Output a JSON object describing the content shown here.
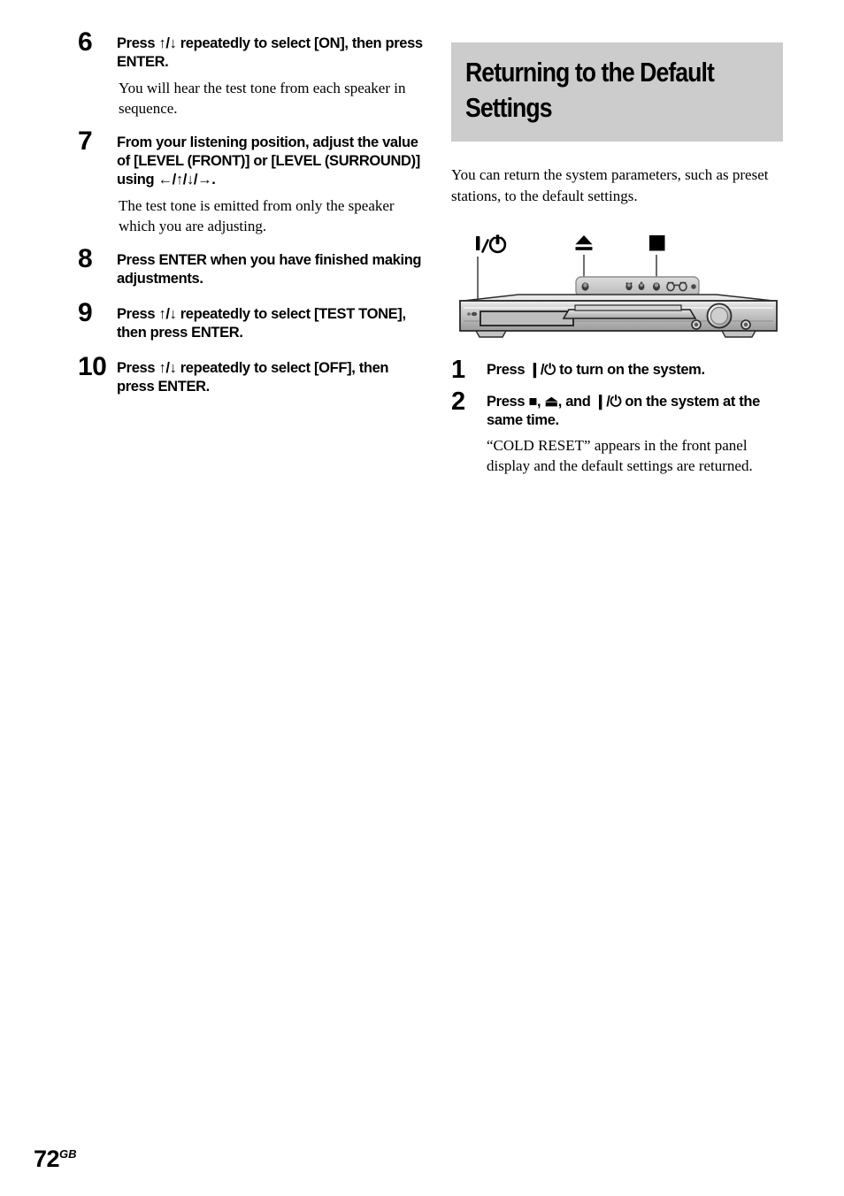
{
  "page": {
    "number": "72",
    "region_code": "GB"
  },
  "left_column": {
    "steps": [
      {
        "number": "6",
        "heading": "Press ↑/↓ repeatedly to select [ON], then press ENTER.",
        "body": "You will hear the test tone from each speaker in sequence."
      },
      {
        "number": "7",
        "heading": "From your listening position, adjust the value of [LEVEL (FRONT)] or [LEVEL (SURROUND)] using ←/↑/↓/→.",
        "body": "The test tone is emitted from only the speaker which you are adjusting."
      },
      {
        "number": "8",
        "heading": "Press ENTER when you have finished making adjustments.",
        "body": ""
      },
      {
        "number": "9",
        "heading": "Press ↑/↓ repeatedly to select [TEST TONE], then press ENTER.",
        "body": ""
      },
      {
        "number": "10",
        "heading": "Press ↑/↓ repeatedly to select [OFF], then press ENTER.",
        "body": ""
      }
    ]
  },
  "right_column": {
    "section_heading_line1": "Returning to the Default",
    "section_heading_line2": "Settings",
    "section_heading_bg": "#cccccc",
    "lead": "You can return the system parameters, such as preset stations, to the default settings.",
    "illustration": {
      "callouts": [
        {
          "symbol": "❙/⏻",
          "name": "power-symbol"
        },
        {
          "symbol": "⏏",
          "name": "eject-symbol"
        },
        {
          "symbol": "■",
          "name": "stop-symbol"
        }
      ],
      "device": "front-panel-of-av-system"
    },
    "steps": [
      {
        "number": "1",
        "heading": "Press ❙/⏻ to turn on the system.",
        "body": ""
      },
      {
        "number": "2",
        "heading": "Press ■, ⏏, and ❙/⏻ on the system at the same time.",
        "body": "“COLD RESET” appears in the front panel display and the default settings are returned."
      }
    ]
  }
}
